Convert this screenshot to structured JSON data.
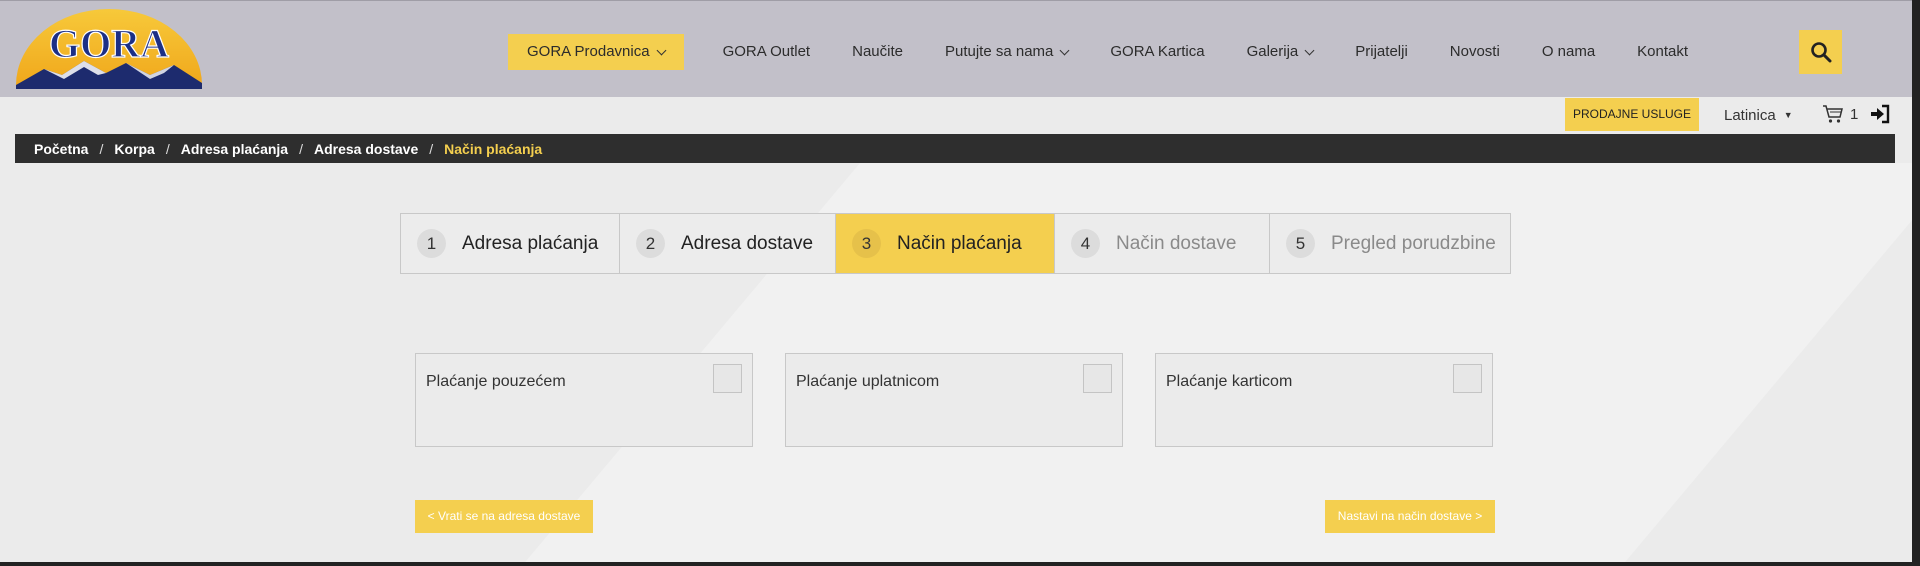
{
  "logo": {
    "text": "GORA"
  },
  "nav": {
    "items": [
      {
        "label": "GORA Prodavnica",
        "dropdown": true,
        "active": true
      },
      {
        "label": "GORA Outlet",
        "dropdown": false
      },
      {
        "label": "Naučite",
        "dropdown": false
      },
      {
        "label": "Putujte sa nama",
        "dropdown": true
      },
      {
        "label": "GORA Kartica",
        "dropdown": false
      },
      {
        "label": "Galerija",
        "dropdown": true
      },
      {
        "label": "Prijatelji",
        "dropdown": false
      },
      {
        "label": "Novosti",
        "dropdown": false
      },
      {
        "label": "O nama",
        "dropdown": false
      },
      {
        "label": "Kontakt",
        "dropdown": false
      }
    ],
    "search_icon": "search-icon"
  },
  "utility": {
    "sales_label": "PRODAJNE USLUGE",
    "language": "Latinica",
    "cart_count": "1",
    "cart_icon": "cart-icon",
    "login_icon": "login-icon"
  },
  "breadcrumb": {
    "items": [
      "Početna",
      "Korpa",
      "Adresa plaćanja",
      "Adresa dostave"
    ],
    "current": "Način plaćanja"
  },
  "steps": [
    {
      "num": "1",
      "label": "Adresa plaćanja",
      "state": "done"
    },
    {
      "num": "2",
      "label": "Adresa dostave",
      "state": "done"
    },
    {
      "num": "3",
      "label": "Način plaćanja",
      "state": "active"
    },
    {
      "num": "4",
      "label": "Način dostave",
      "state": "todo"
    },
    {
      "num": "5",
      "label": "Pregled porudzbine",
      "state": "todo"
    }
  ],
  "payment_options": [
    {
      "label": "Plaćanje pouzećem",
      "checked": false
    },
    {
      "label": "Plaćanje uplatnicom",
      "checked": false
    },
    {
      "label": "Plaćanje karticom",
      "checked": false
    }
  ],
  "actions": {
    "back_label": "< Vrati se na adresa dostave",
    "next_label": "Nastavi na način dostave >"
  },
  "colors": {
    "accent": "#f4cf4f",
    "header_bg": "#c2c0c9",
    "breadcrumb_bg": "#2e2e2e",
    "logo_blue": "#1c2f86"
  }
}
